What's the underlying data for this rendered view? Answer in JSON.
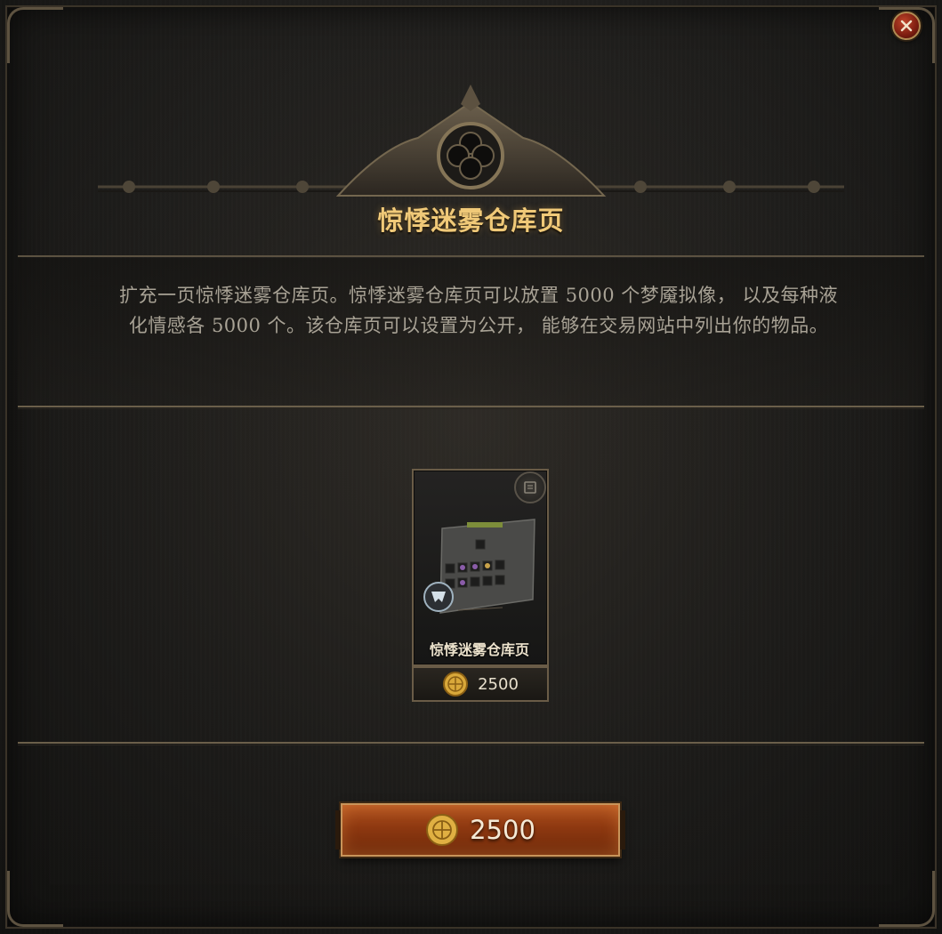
{
  "dialog": {
    "title": "惊悸迷雾仓库页",
    "description": "扩充一页惊悸迷雾仓库页。惊悸迷雾仓库页可以放置 5000 个梦魇拟像， 以及每种液化情感各 5000 个。该仓库页可以设置为公开， 能够在交易网站中列出你的物品。"
  },
  "item_card": {
    "name": "惊悸迷雾仓库页",
    "price": "2500",
    "icon": "stash-tab-icon",
    "badge_icon": "scroll-icon"
  },
  "purchase_button": {
    "price": "2500",
    "icon": "coin-icon"
  },
  "colors": {
    "title": "#f0c978",
    "button": "#8d3810",
    "close": "#7c1d10"
  }
}
